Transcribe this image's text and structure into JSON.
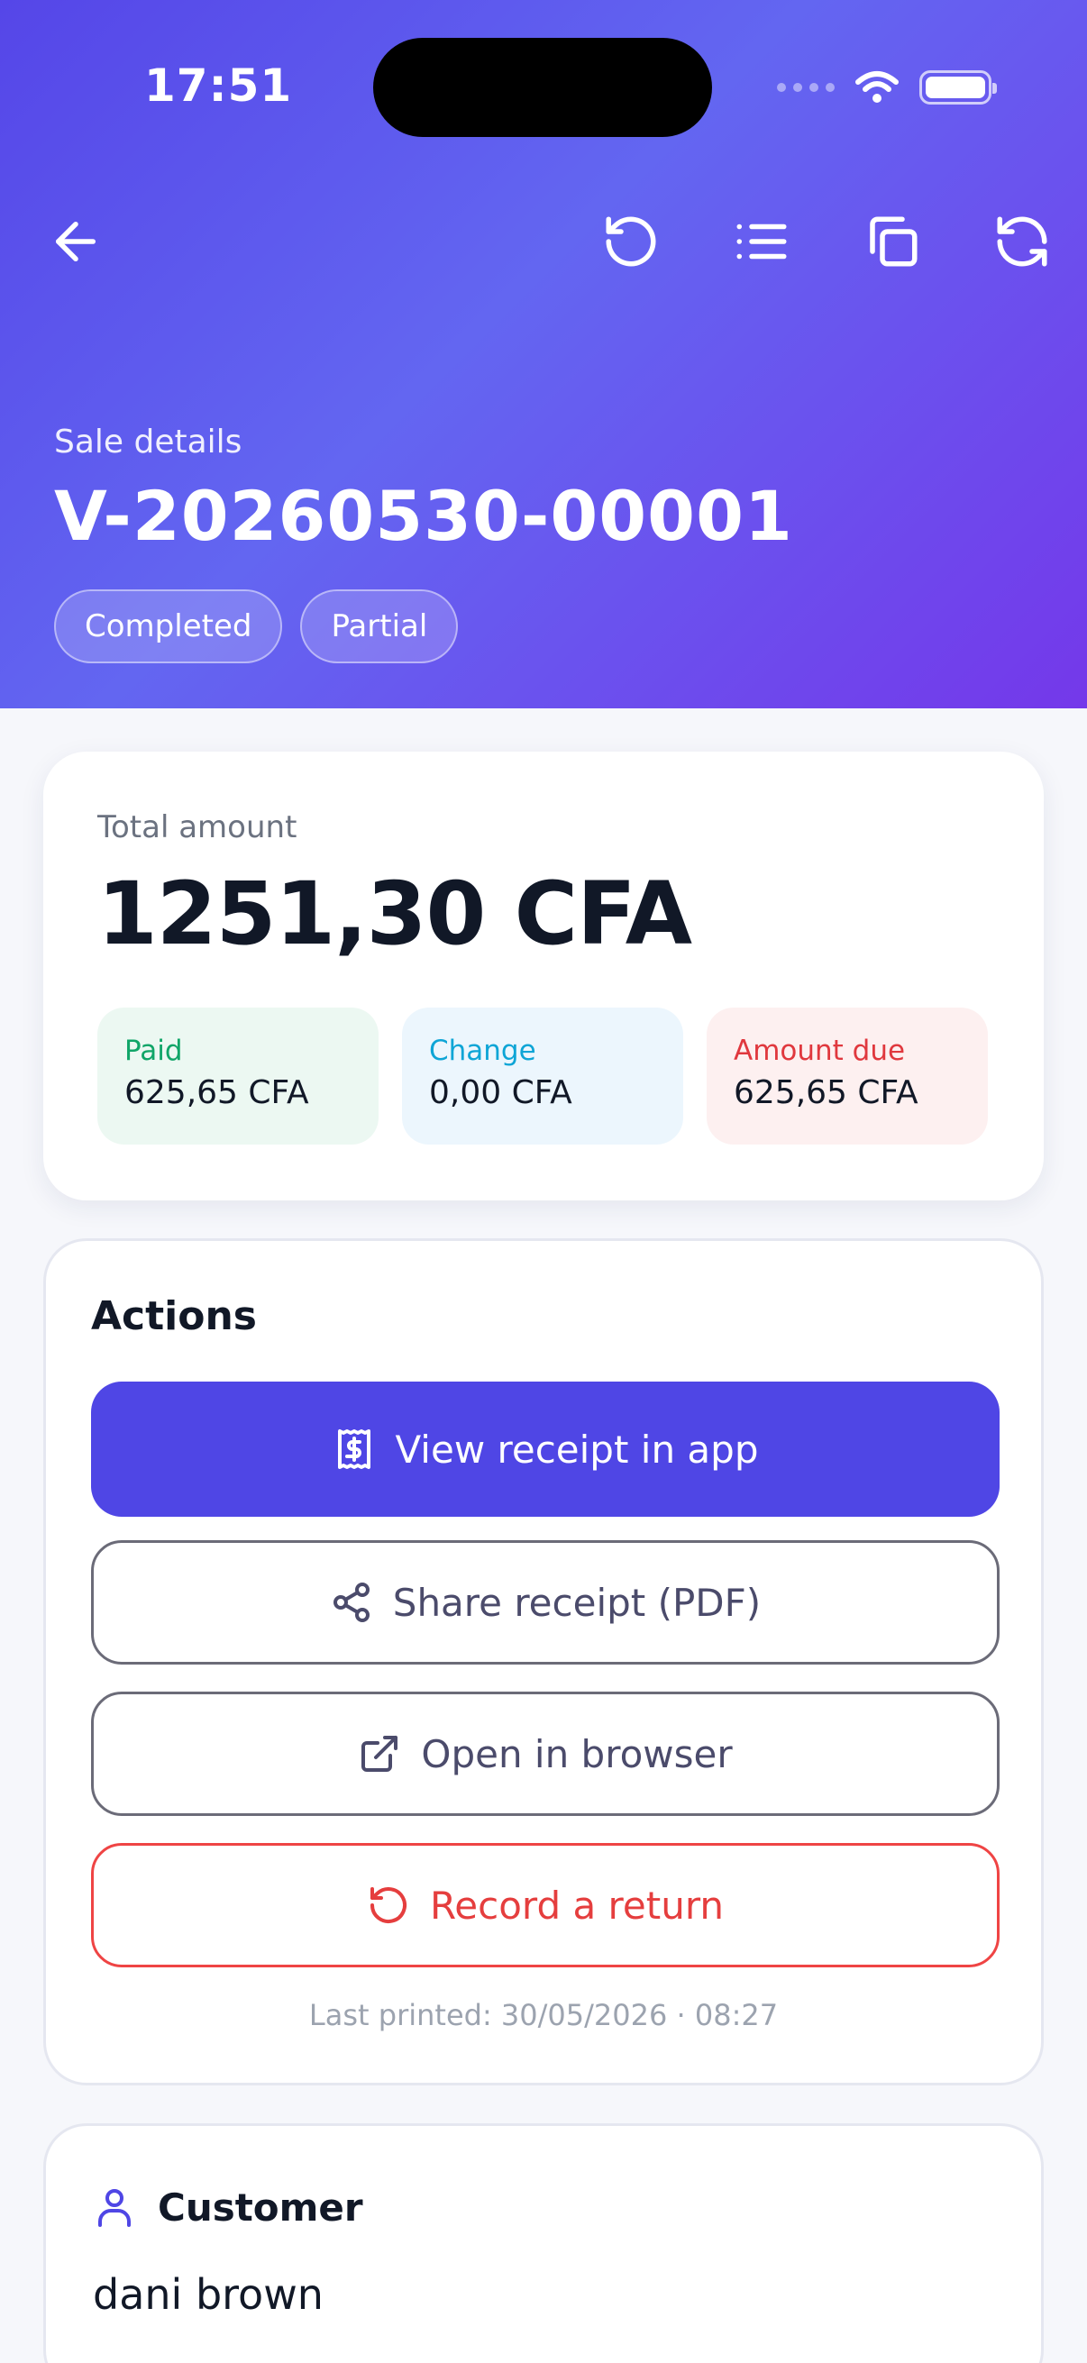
{
  "status_bar": {
    "time": "17:51"
  },
  "header": {
    "subtitle": "Sale details",
    "title": "V-20260530-00001",
    "chips": [
      "Completed",
      "Partial"
    ]
  },
  "icons": {
    "back": "arrow-left-icon",
    "history": "undo-icon",
    "list": "list-icon",
    "copy": "copy-icon",
    "refresh": "refresh-icon"
  },
  "summary": {
    "total_label": "Total amount",
    "total_value": "1251,30 CFA",
    "paid_label": "Paid",
    "paid_value": "625,65 CFA",
    "change_label": "Change",
    "change_value": "0,00 CFA",
    "due_label": "Amount due",
    "due_value": "625,65 CFA"
  },
  "actions": {
    "title": "Actions",
    "view_receipt": "View receipt in app",
    "share_receipt": "Share receipt (PDF)",
    "open_browser": "Open in browser",
    "record_return": "Record a return",
    "last_printed": "Last printed: 30/05/2026 · 08:27"
  },
  "customer": {
    "title": "Customer",
    "name": "dani brown"
  },
  "colors": {
    "accent": "#4f46e5",
    "paid": "#10a568",
    "change": "#0ea5d6",
    "due": "#e0383e"
  }
}
